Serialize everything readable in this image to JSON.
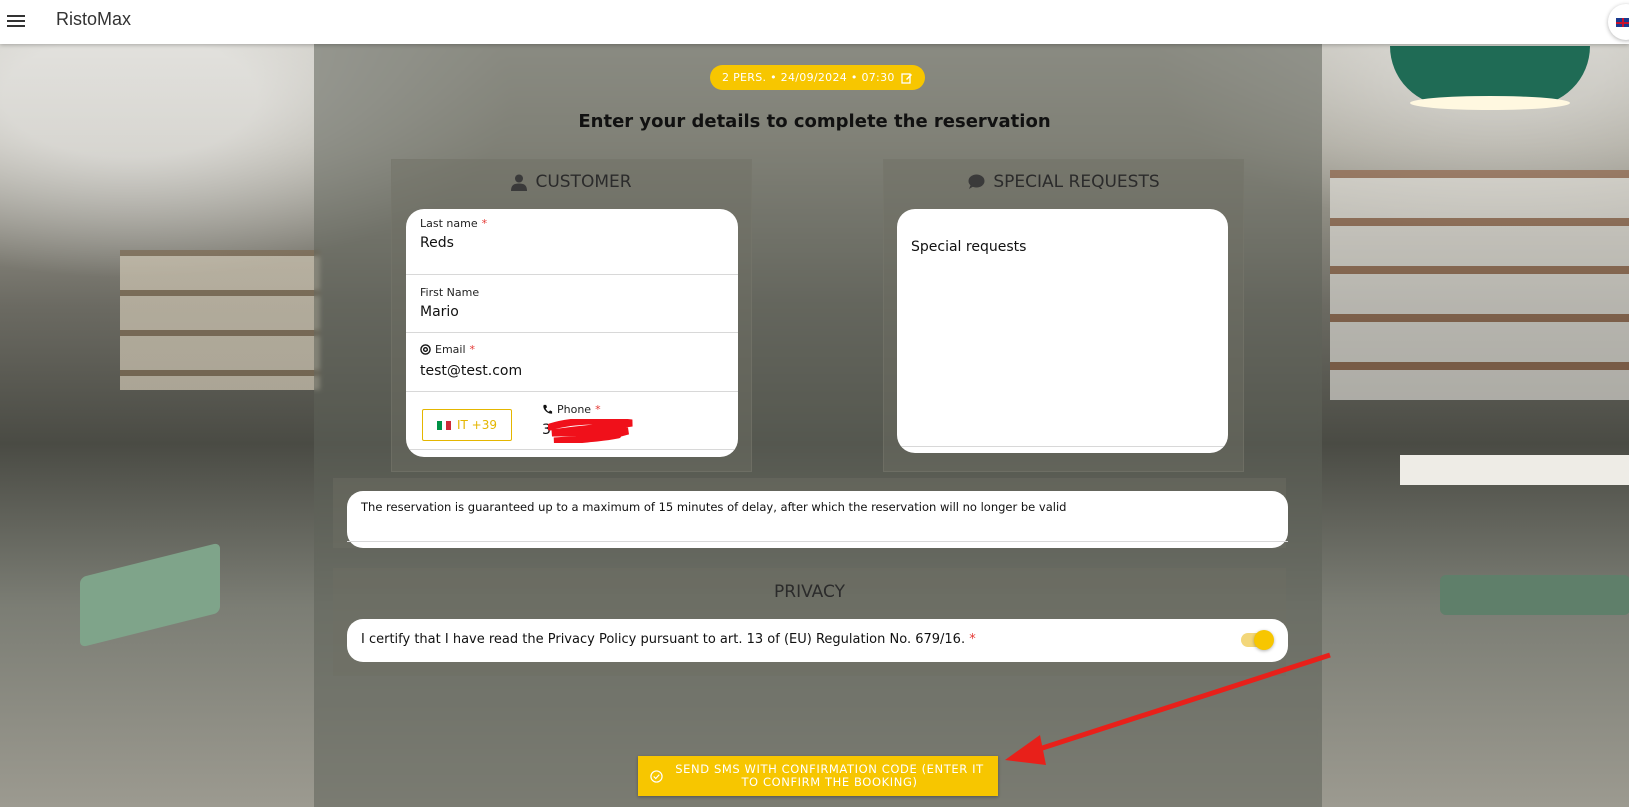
{
  "app": {
    "title": "RistoMax"
  },
  "header": {
    "menu_icon": "hamburger-menu-icon",
    "language_flag": "uk-flag-icon"
  },
  "booking": {
    "summary": "2 PERS. • 24/09/2024 • 07:30",
    "edit_icon": "edit-icon",
    "headline": "Enter your details to complete the reservation"
  },
  "customer": {
    "title": "CUSTOMER",
    "icon": "user-icon",
    "last_name_label": "Last name",
    "last_name_value": "Reds",
    "first_name_label": "First Name",
    "first_name_value": "Mario",
    "email_label": "Email",
    "email_icon": "at-icon",
    "email_value": "test@test.com",
    "country_code": "IT +39",
    "phone_label": "Phone",
    "phone_icon": "phone-icon",
    "phone_value": "3",
    "required_mark": "*"
  },
  "special_requests": {
    "title": "SPECIAL REQUESTS",
    "icon": "chat-bubble-icon",
    "text": "Special requests"
  },
  "notice": {
    "text": "The reservation is guaranteed up to a maximum of 15 minutes of delay, after which the reservation will no longer be valid"
  },
  "privacy": {
    "title": "PRIVACY",
    "consent_text": "I certify that I have read the Privacy Policy pursuant to art. 13 of (EU) Regulation No. 679/16.",
    "required_mark": "*",
    "toggle_on": true
  },
  "submit": {
    "label": "SEND SMS WITH CONFIRMATION CODE (ENTER IT TO CONFIRM THE BOOKING)",
    "icon": "check-circle-icon"
  },
  "colors": {
    "accent": "#f7c600",
    "required": "#e53935",
    "arrow": "#e8201a"
  }
}
